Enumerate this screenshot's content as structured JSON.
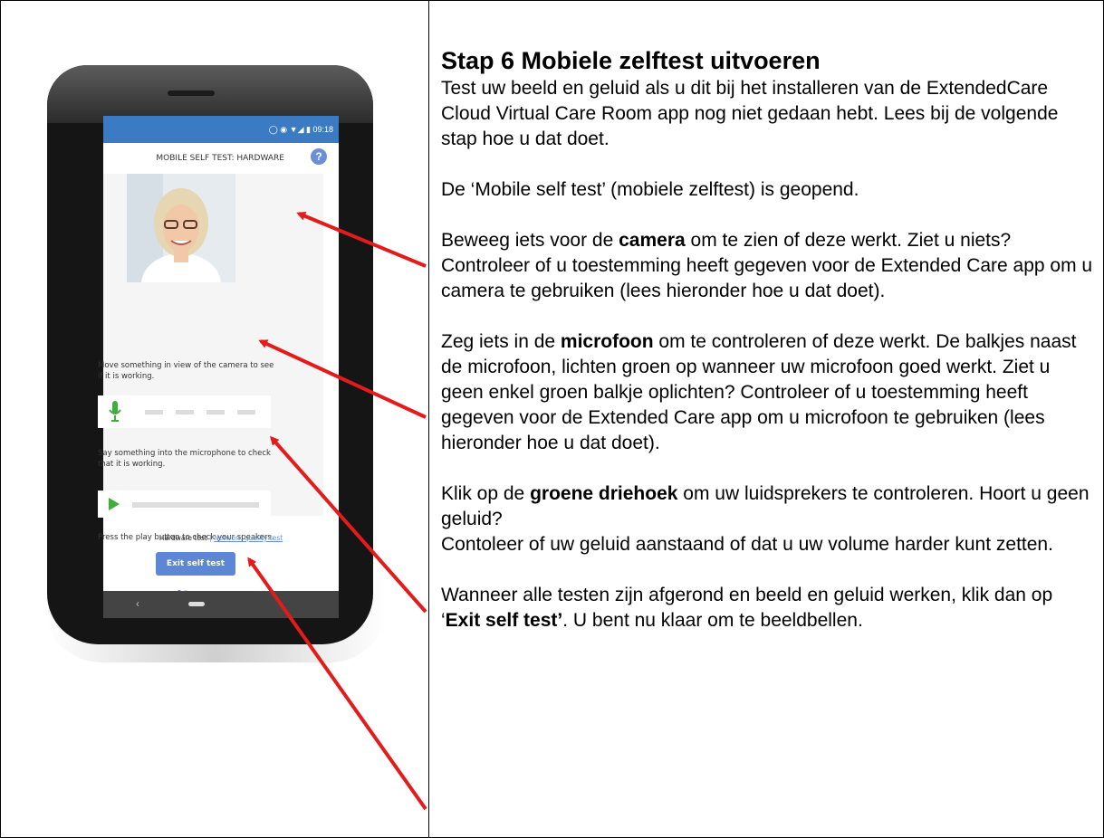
{
  "phone": {
    "status_time": "09:18",
    "screen_title": "MOBILE SELF TEST: HARDWARE",
    "help_icon": "?",
    "camera_caption": "Move something in view of the camera to see if it is working.",
    "mic_caption": "Say something into the microphone to check that it is working.",
    "speaker_caption": "Press the play button to check your speakers.",
    "link_hardware": "Hardware test",
    "link_separator": "|",
    "link_network": "Network quality test",
    "exit_button": "Exit self test",
    "colors": {
      "status_bar": "#3a7bc4",
      "button": "#5b87d4",
      "green": "#3fae3a"
    }
  },
  "content": {
    "heading": "Stap 6  Mobiele zelftest uitvoeren",
    "intro": "Test uw beeld en geluid als u dit bij het installeren van de ExtendedCare Cloud Virtual Care Room app nog niet gedaan hebt. Lees bij de volgende stap hoe u dat doet.",
    "opened": "De ‘Mobile self test’ (mobiele zelftest) is geopend.",
    "camera_pre": "Beweeg iets voor de ",
    "camera_bold": "camera",
    "camera_post": " om te zien of deze werkt. Ziet u niets? Controleer of u toestemming heeft gegeven voor de Extended Care app om u camera te gebruiken (lees hieronder hoe u dat doet).",
    "mic_pre": "Zeg iets in de ",
    "mic_bold": "microfoon",
    "mic_post": " om te controleren of deze werkt. De balkjes naast de microfoon, lichten groen op wanneer uw microfoon goed werkt. Ziet u geen enkel groen balkje oplichten? Controleer of u toestemming heeft gegeven voor de Extended Care app om u microfoon te gebruiken (lees hieronder hoe u dat doet).",
    "speaker_pre": "Klik op de ",
    "speaker_bold": "groene driehoek",
    "speaker_post": " om uw luidsprekers te controleren. Hoort u geen geluid?",
    "speaker_line2": "Contoleer of uw geluid aanstaand of dat u uw volume harder kunt zetten.",
    "finish_pre": "Wanneer alle testen zijn afgerond en beeld en geluid werken, klik dan op ‘",
    "finish_bold": "Exit self test’",
    "finish_post": ". U bent nu klaar om te beeldbellen."
  },
  "colors": {
    "arrow": "#e31b1b"
  }
}
